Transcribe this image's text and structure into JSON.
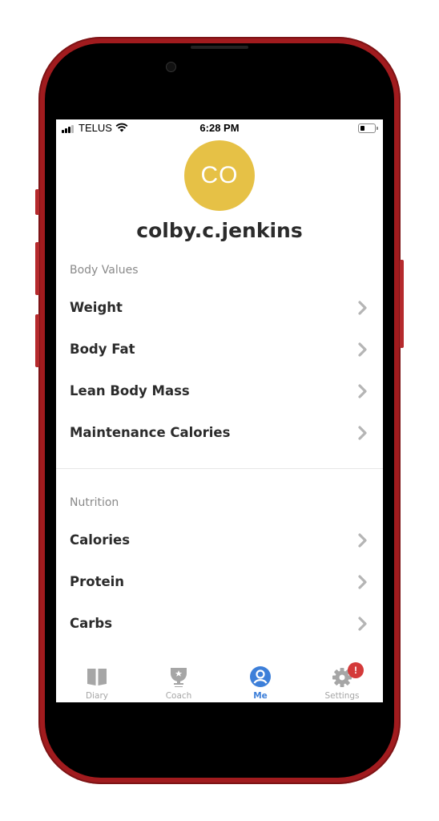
{
  "status_bar": {
    "carrier": "TELUS",
    "time": "6:28 PM",
    "battery_level": 0.3
  },
  "profile": {
    "initials": "CO",
    "username": "colby.c.jenkins",
    "avatar_color": "#e6c146"
  },
  "sections": [
    {
      "title": "Body Values",
      "items": [
        {
          "label": "Weight"
        },
        {
          "label": "Body Fat"
        },
        {
          "label": "Lean Body Mass"
        },
        {
          "label": "Maintenance Calories"
        }
      ]
    },
    {
      "title": "Nutrition",
      "items": [
        {
          "label": "Calories"
        },
        {
          "label": "Protein"
        },
        {
          "label": "Carbs"
        }
      ]
    }
  ],
  "tab_bar": {
    "tabs": [
      {
        "label": "Diary",
        "icon": "book-icon",
        "active": false
      },
      {
        "label": "Coach",
        "icon": "trophy-icon",
        "active": false
      },
      {
        "label": "Me",
        "icon": "person-icon",
        "active": true
      },
      {
        "label": "Settings",
        "icon": "gear-icon",
        "active": false
      }
    ],
    "settings_badge": "!",
    "active_color": "#3d7fd9",
    "badge_color": "#d43a3a"
  }
}
